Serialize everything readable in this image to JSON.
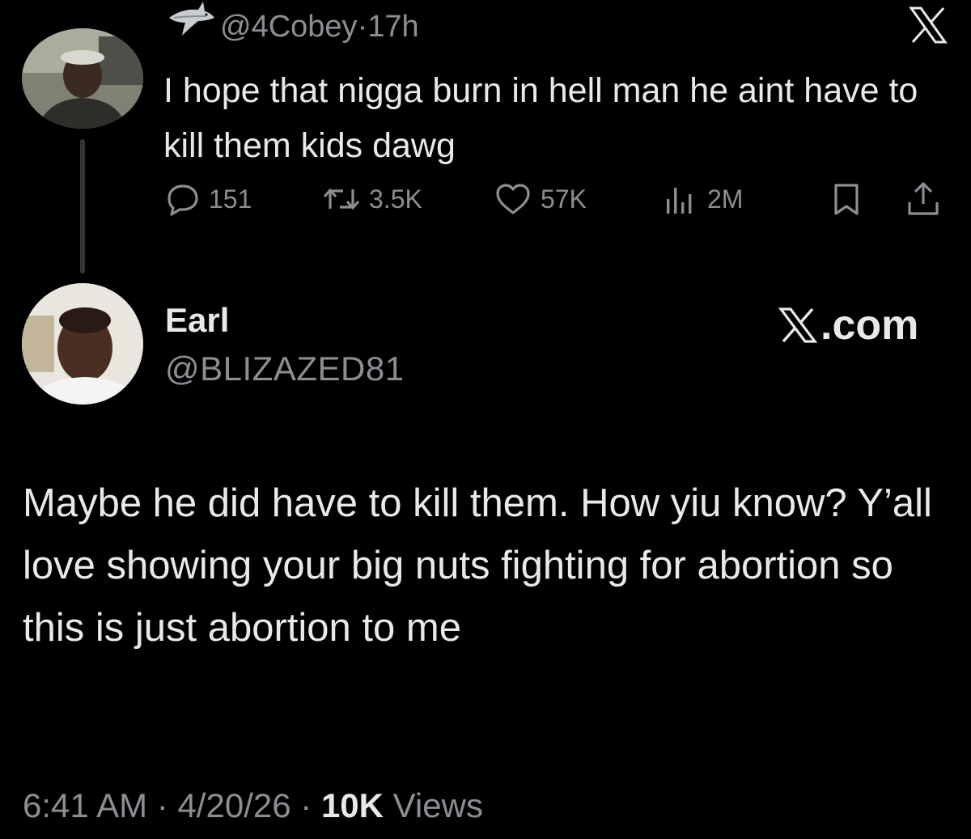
{
  "tweet1": {
    "handle": "@4Cobey",
    "separator": "·",
    "time": "17h",
    "text": "I hope that nigga burn in hell man he aint have to kill them kids dawg",
    "stats": {
      "replies": "151",
      "retweets": "3.5K",
      "likes": "57K",
      "views": "2M"
    },
    "icons": {
      "badge": "shark-icon",
      "brand": "x-logo-icon",
      "reply": "reply-icon",
      "retweet": "retweet-icon",
      "like": "heart-icon",
      "views": "views-chart-icon",
      "bookmark": "bookmark-icon",
      "share": "share-icon"
    }
  },
  "tweet2": {
    "name": "Earl",
    "handle": "@BLIZAZED81",
    "brand": ".com",
    "text": "Maybe he did have to kill them. How yiu know? Y’all love showing your big nuts fighting for abortion so this is just abortion to me",
    "meta": {
      "time": "6:41 AM",
      "separator": "·",
      "date": "4/20/26",
      "views_count": "10K",
      "views_label": "Views"
    }
  },
  "colors": {
    "background": "#000000",
    "text_primary": "#e7e9ea",
    "text_secondary": "#8b8f94",
    "thread_line": "#333639"
  }
}
